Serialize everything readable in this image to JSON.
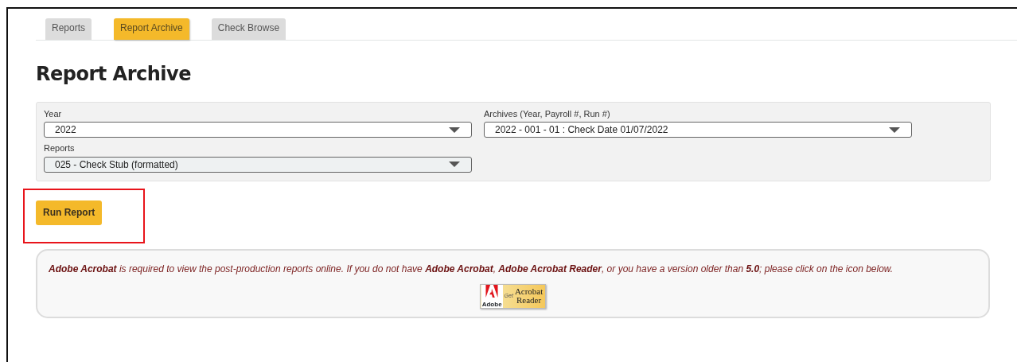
{
  "tabs": [
    {
      "label": "Reports",
      "selected": false
    },
    {
      "label": "Report Archive",
      "selected": true
    },
    {
      "label": "Check Browse",
      "selected": false
    }
  ],
  "title": "Report Archive",
  "filters": [
    {
      "label": "Year",
      "value": "2022",
      "kind": "plain"
    },
    {
      "label": "Archives (Year, Payroll #, Run #)",
      "value": "2022 - 001 - 01 : Check Date 01/07/2022",
      "kind": "plain"
    },
    {
      "label": "Reports",
      "value": "025 - Check Stub (formatted)",
      "kind": "tinted"
    }
  ],
  "run_button": {
    "label": "Run Report",
    "highlighted": true
  },
  "notice": {
    "text": "**Adobe Acrobat** is required to view the post-production reports online. If you do not have **Adobe Acrobat**, **Adobe Acrobat Reader**, or you have a version older than **5.0**; please click on the icon below.",
    "badge": {
      "brand": "Adobe",
      "get": "Get",
      "line1": "Acrobat",
      "line2": "Reader"
    }
  }
}
